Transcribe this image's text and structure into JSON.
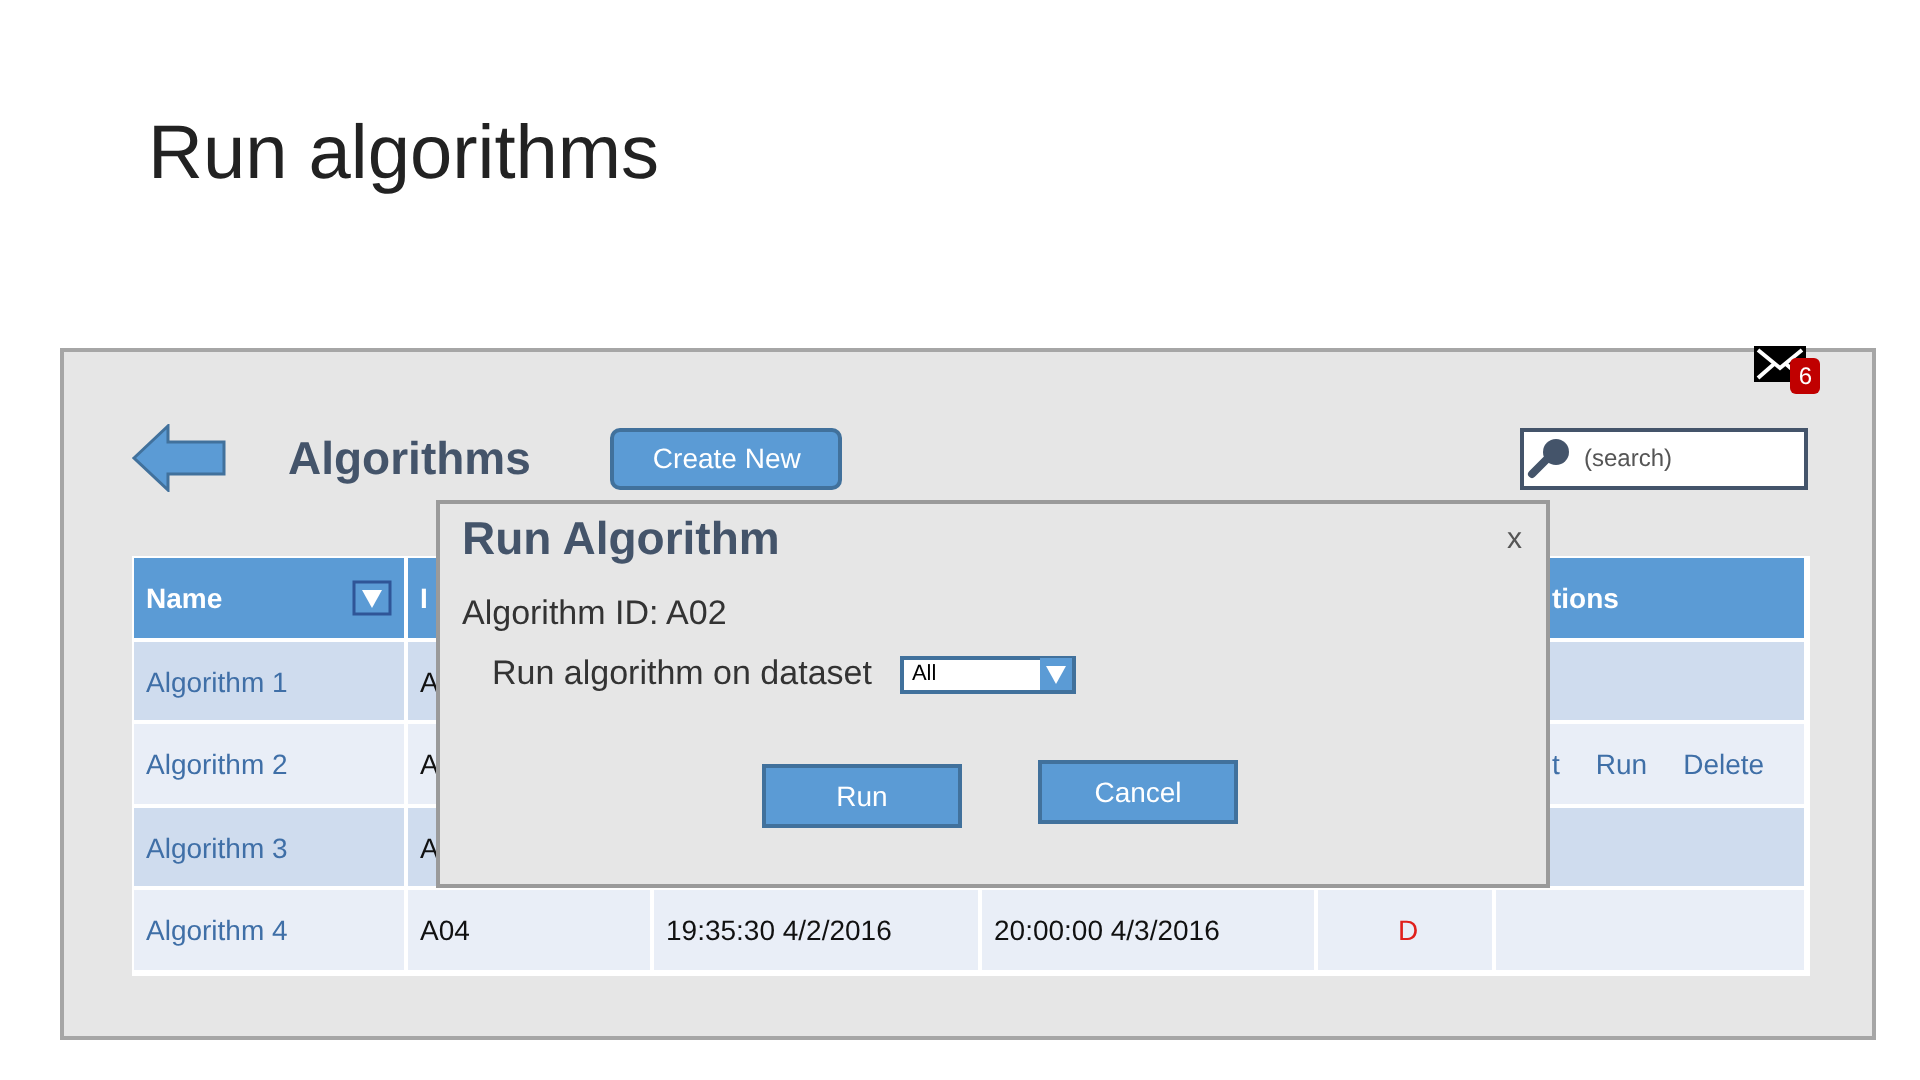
{
  "slide": {
    "title": "Run algorithms"
  },
  "header": {
    "title": "Algorithms",
    "create_button": "Create New",
    "search": {
      "placeholder": "(search)"
    },
    "notifications": {
      "count": "6"
    }
  },
  "table": {
    "columns": [
      {
        "label": "Name",
        "filter": true
      },
      {
        "label": "I"
      },
      {
        "label": "tions"
      }
    ],
    "rows": [
      {
        "name": "Algorithm 1",
        "id": "A"
      },
      {
        "name": "Algorithm 2",
        "id": "A",
        "actions": [
          "t",
          "Run",
          "Delete"
        ]
      },
      {
        "name": "Algorithm 3",
        "id": "A"
      },
      {
        "name": "Algorithm 4",
        "id": "A04",
        "started": "19:35:30 4/2/2016",
        "finished": "20:00:00 4/3/2016",
        "status": "D"
      }
    ]
  },
  "dialog": {
    "title": "Run Algorithm",
    "close": "x",
    "algorithm_id": "Algorithm ID: A02",
    "dataset_label": "Run algorithm on dataset",
    "dataset_value": "All",
    "buttons": [
      "Run",
      "Cancel"
    ]
  }
}
